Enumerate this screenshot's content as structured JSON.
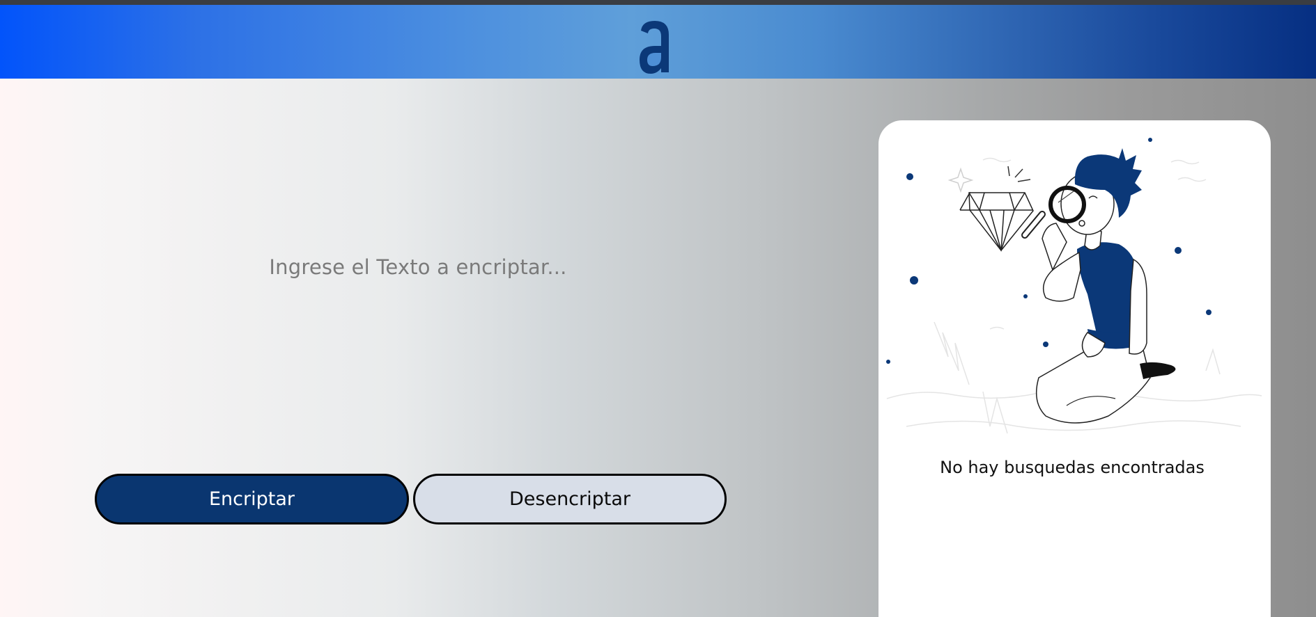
{
  "header": {
    "logo": "alura-a-logo",
    "accent_colors": [
      "#0254fb",
      "#5f9fd9",
      "#062f82"
    ]
  },
  "main": {
    "input": {
      "placeholder": "Ingrese el Texto a encriptar...",
      "value": ""
    },
    "buttons": {
      "encrypt_label": "Encriptar",
      "decrypt_label": "Desencriptar",
      "encrypt_color": "#0a3670",
      "decrypt_color": "#d8dee8"
    }
  },
  "result_panel": {
    "illustration": "person-with-magnifying-glass-and-diamond",
    "empty_message": "No hay busquedas encontradas"
  }
}
